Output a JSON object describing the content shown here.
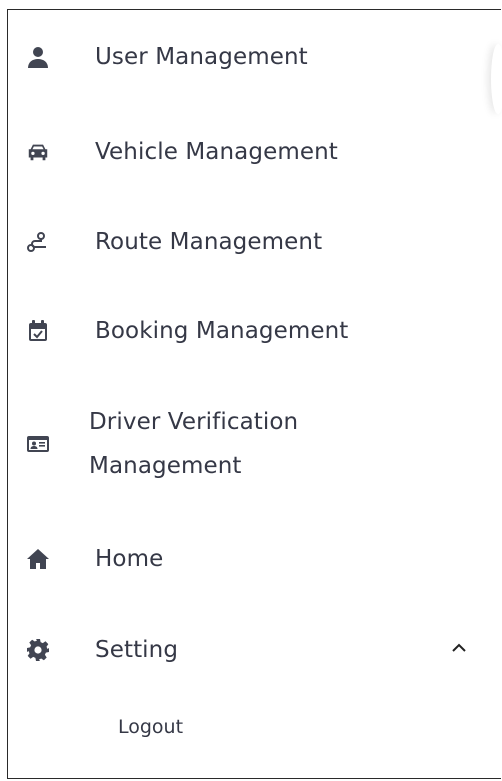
{
  "menu": {
    "items": [
      {
        "label": "User Management",
        "icon": "user-icon"
      },
      {
        "label": "Vehicle Management",
        "icon": "car-icon"
      },
      {
        "label": "Route Management",
        "icon": "route-icon"
      },
      {
        "label": "Booking Management",
        "icon": "calendar-check-icon"
      },
      {
        "label_line1": "Driver Verification",
        "label_line2": "Management",
        "icon": "id-card-icon"
      },
      {
        "label": "Home",
        "icon": "home-icon"
      },
      {
        "label": "Setting",
        "icon": "gear-icon",
        "expanded": true,
        "expand_icon": "chevron-up-icon"
      }
    ],
    "submenu": [
      {
        "label": "Logout"
      }
    ]
  },
  "colors": {
    "text": "#353846",
    "icon": "#414552",
    "border": "#2a2a2a"
  }
}
